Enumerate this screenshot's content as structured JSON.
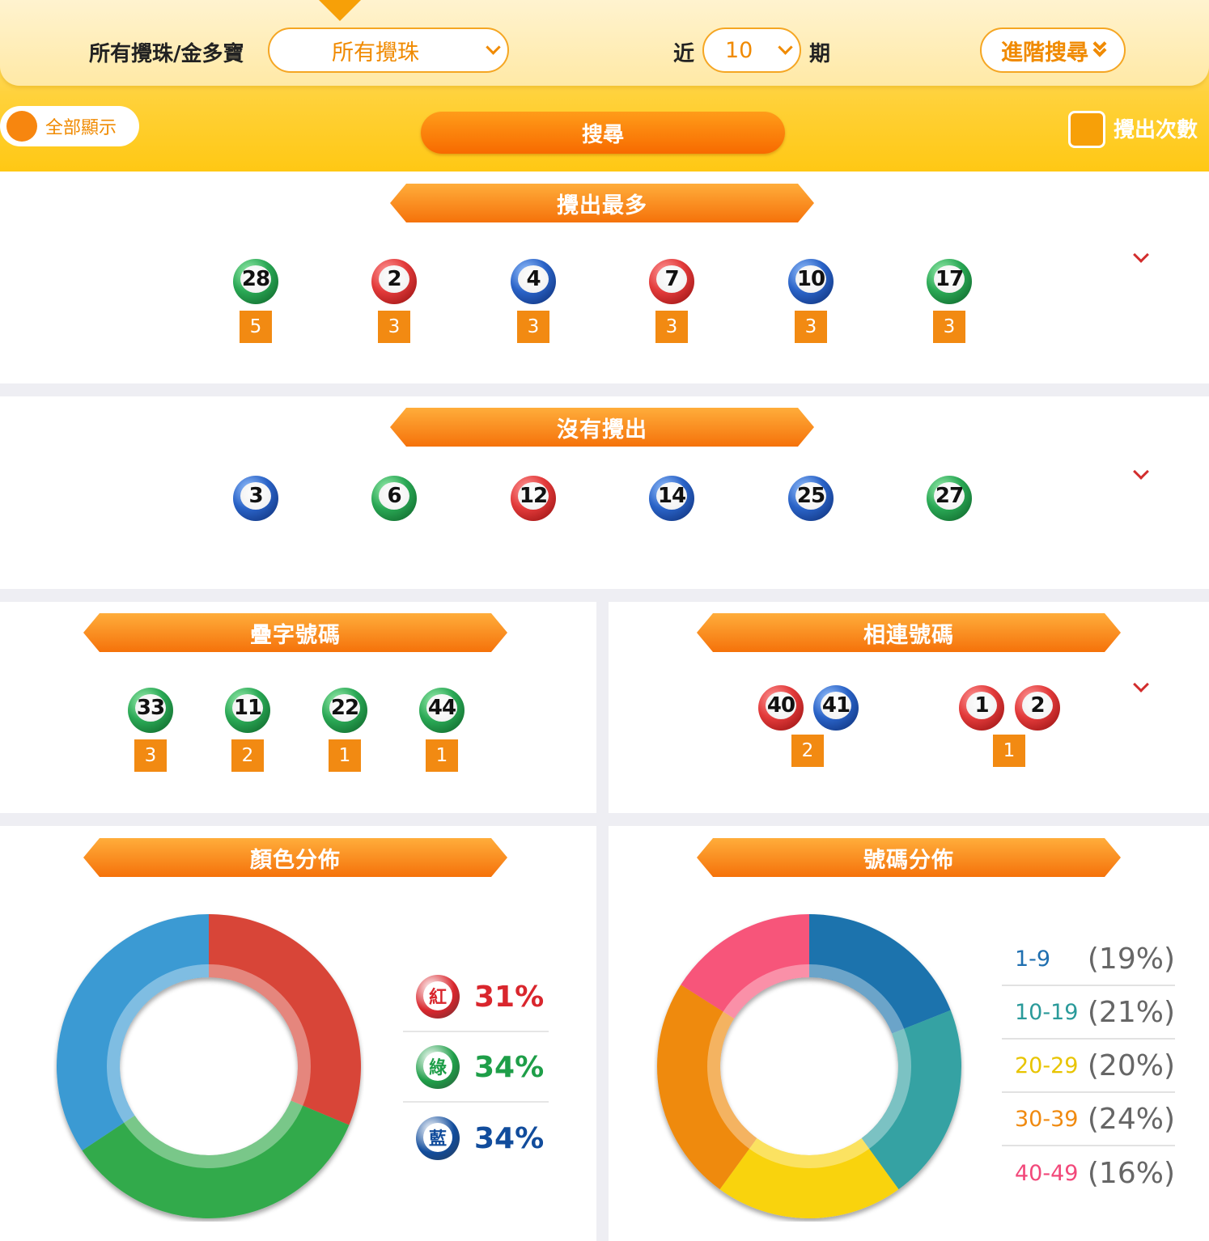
{
  "filter": {
    "category_label": "所有攪珠/金多寶",
    "draw_type_value": "所有攪珠",
    "recent_prefix": "近",
    "recent_value": "10",
    "recent_suffix": "期",
    "advanced_search_label": "進階搜尋"
  },
  "controls": {
    "show_all_label": "全部顯示",
    "search_label": "搜尋",
    "draw_times_label": "攪出次數"
  },
  "most_drawn": {
    "title": "攪出最多",
    "balls": [
      {
        "number": "28",
        "color": "green",
        "count": "5"
      },
      {
        "number": "2",
        "color": "red",
        "count": "3"
      },
      {
        "number": "4",
        "color": "blue",
        "count": "3"
      },
      {
        "number": "7",
        "color": "red",
        "count": "3"
      },
      {
        "number": "10",
        "color": "blue",
        "count": "3"
      },
      {
        "number": "17",
        "color": "green",
        "count": "3"
      }
    ]
  },
  "not_drawn": {
    "title": "沒有攪出",
    "balls": [
      {
        "number": "3",
        "color": "blue"
      },
      {
        "number": "6",
        "color": "green"
      },
      {
        "number": "12",
        "color": "red"
      },
      {
        "number": "14",
        "color": "blue"
      },
      {
        "number": "25",
        "color": "blue"
      },
      {
        "number": "27",
        "color": "green"
      }
    ]
  },
  "repeat_numbers": {
    "title": "疊字號碼",
    "balls": [
      {
        "number": "33",
        "color": "green",
        "count": "3"
      },
      {
        "number": "11",
        "color": "green",
        "count": "2"
      },
      {
        "number": "22",
        "color": "green",
        "count": "1"
      },
      {
        "number": "44",
        "color": "green",
        "count": "1"
      }
    ]
  },
  "consecutive_numbers": {
    "title": "相連號碼",
    "pairs": [
      {
        "balls": [
          {
            "number": "40",
            "color": "red"
          },
          {
            "number": "41",
            "color": "blue"
          }
        ],
        "count": "2"
      },
      {
        "balls": [
          {
            "number": "1",
            "color": "red"
          },
          {
            "number": "2",
            "color": "red"
          }
        ],
        "count": "1"
      }
    ]
  },
  "color_distribution": {
    "title": "顏色分佈",
    "legend": [
      {
        "char": "紅",
        "percent": "31%",
        "color": "#d9262d"
      },
      {
        "char": "綠",
        "percent": "34%",
        "color": "#1e9e48"
      },
      {
        "char": "藍",
        "percent": "34%",
        "color": "#114c9c"
      }
    ]
  },
  "number_distribution": {
    "title": "號碼分佈",
    "legend": [
      {
        "range": "1-9",
        "percent": "(19%)",
        "color": "#1f6fb0"
      },
      {
        "range": "10-19",
        "percent": "(21%)",
        "color": "#2a9a9a"
      },
      {
        "range": "20-29",
        "percent": "(20%)",
        "color": "#e8c400"
      },
      {
        "range": "30-39",
        "percent": "(24%)",
        "color": "#f08a10"
      },
      {
        "range": "40-49",
        "percent": "(16%)",
        "color": "#f2487a"
      }
    ]
  },
  "chart_data": [
    {
      "type": "pie",
      "donut": true,
      "categories": [
        "紅",
        "綠",
        "藍"
      ],
      "values": [
        31,
        34,
        34
      ],
      "colors": [
        "#d84538",
        "#33aa4c",
        "#3a9ad3"
      ]
    },
    {
      "type": "pie",
      "donut": true,
      "categories": [
        "1-9",
        "10-19",
        "20-29",
        "30-39",
        "40-49"
      ],
      "values": [
        19,
        21,
        20,
        24,
        16
      ],
      "colors": [
        "#1b73ad",
        "#35a2a3",
        "#f9d309",
        "#ef8a0b",
        "#f7547a"
      ]
    }
  ]
}
